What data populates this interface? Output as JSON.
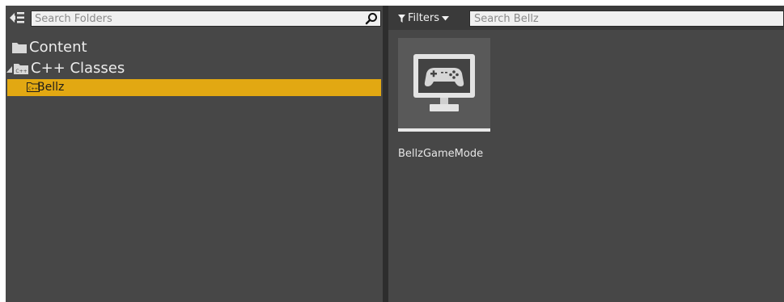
{
  "folder_panel": {
    "search_placeholder": "Search Folders",
    "tree": [
      {
        "label": "Content",
        "icon": "folder-icon"
      },
      {
        "label": "C++ Classes",
        "icon": "cpp-folder-icon",
        "expanded": true
      },
      {
        "label": "Bellz",
        "icon": "cpp-folder-icon",
        "selected": true
      }
    ]
  },
  "asset_panel": {
    "filters_label": "Filters",
    "search_placeholder": "Search Bellz",
    "assets": [
      {
        "label": "BellzGameMode",
        "icon": "game-mode-icon"
      }
    ]
  },
  "colors": {
    "panel": "#474747",
    "selection": "#e2a812",
    "toolbar_dark": "#3a3a3a"
  }
}
